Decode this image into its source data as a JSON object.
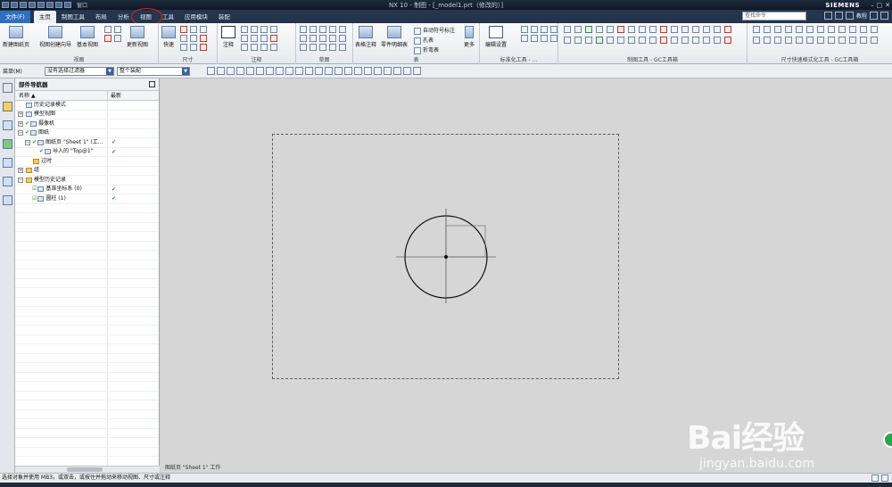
{
  "titlebar": {
    "window_menu": "窗口",
    "title": "NX 10 - 制图 - [_model1.prt（修改的）]",
    "brand": "SIEMENS",
    "controls": [
      "–",
      "□",
      "✕"
    ]
  },
  "menu": {
    "file": "文件(F)",
    "tabs": [
      "主页",
      "制图工具",
      "布局",
      "分析",
      "视图",
      "工具",
      "应用模块",
      "装配"
    ],
    "search_placeholder": "查找命令",
    "help": "教程"
  },
  "ribbon": {
    "groups": {
      "new_sheet": "新建图纸页",
      "view_wizard": "视图创建向导",
      "base_view": "基本视图",
      "update_view": "更新视图",
      "view_group": "视图",
      "quick": "快速",
      "dimension_group": "尺寸",
      "note": "注释",
      "annotation_group": "注释",
      "sketch_group": "草图",
      "table_note": "表格注释",
      "parts_list": "零件明细表",
      "auto_balloon": "自动符号标注",
      "hole_table": "孔表",
      "bend_table": "折弯表",
      "table_group": "表",
      "more": "更多",
      "edit_settings": "编辑设置",
      "std_tools": "标准化工具 - ...",
      "drafting_gc": "制图工具 - GC工具箱",
      "dim_gc": "尺寸快速格式化工具 - GC工具箱"
    }
  },
  "selbar": {
    "menu": "菜单(M)",
    "filter": "没有选择过滤器",
    "scope": "整个装配"
  },
  "navigator": {
    "title": "部件导航器",
    "col_name": "名称",
    "col_latest": "最新",
    "rows": [
      {
        "indent": 0,
        "exp": "",
        "check": "",
        "icon": "history-mode",
        "label": "历史记录模式",
        "latest": ""
      },
      {
        "indent": 0,
        "exp": "+",
        "check": "",
        "icon": "model-views",
        "label": "模型视图",
        "latest": ""
      },
      {
        "indent": 0,
        "exp": "+",
        "check": "✔",
        "icon": "camera",
        "label": "摄像机",
        "latest": ""
      },
      {
        "indent": 0,
        "exp": "−",
        "check": "✔",
        "icon": "drawing",
        "label": "图纸",
        "latest": ""
      },
      {
        "indent": 1,
        "exp": "−",
        "check": "✔",
        "icon": "sheet",
        "label": "图纸页 \"Sheet 1\" (工...",
        "latest": "✔"
      },
      {
        "indent": 2,
        "exp": "",
        "check": "✔",
        "icon": "imported-view",
        "label": "导入的 \"Top@1\"",
        "latest": "✔"
      },
      {
        "indent": 1,
        "exp": "",
        "check": "",
        "icon": "outdated",
        "label": "过时",
        "latest": ""
      },
      {
        "indent": 0,
        "exp": "+",
        "check": "",
        "icon": "folder",
        "label": "组",
        "latest": ""
      },
      {
        "indent": 0,
        "exp": "−",
        "check": "",
        "icon": "folder",
        "label": "模型历史记录",
        "latest": ""
      },
      {
        "indent": 1,
        "exp": "",
        "check": "☑",
        "icon": "datum-csys",
        "label": "基准坐标系 (0)",
        "latest": "✔"
      },
      {
        "indent": 1,
        "exp": "",
        "check": "☑",
        "icon": "cylinder",
        "label": "圆柱 (1)",
        "latest": "✔"
      }
    ]
  },
  "canvas": {
    "sheet_label": "图纸页 \"Sheet 1\" 工作"
  },
  "status": {
    "text": "选择对象并使用 MB3，或双击，或按住并拖动来移动视图、尺寸或注释"
  },
  "watermark": {
    "line1": "Bai经验",
    "line2": "jingyan.baidu.com"
  }
}
